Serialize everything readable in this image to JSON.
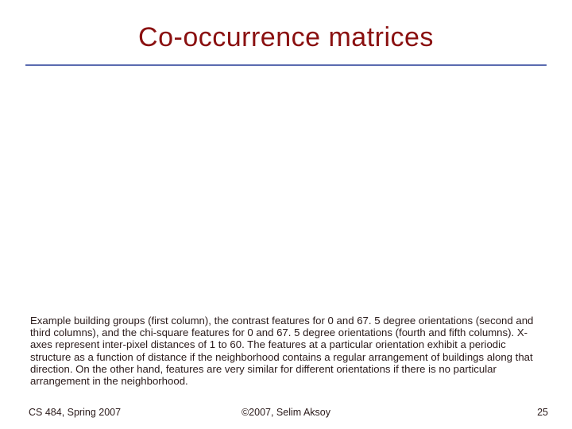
{
  "slide": {
    "title": "Co-occurrence matrices",
    "body": "Example building groups (first column), the contrast features for 0 and 67. 5 degree orientations (second and third columns), and the chi-square features for 0 and 67. 5 degree orientations (fourth and fifth columns). X-axes represent inter-pixel distances of 1 to 60. The features at a particular orientation exhibit a periodic structure as a function of distance if the neighborhood contains a regular arrangement of buildings along that direction. On the other hand, features are very similar for different orientations if there is no particular arrangement in the neighborhood."
  },
  "footer": {
    "left": "CS 484, Spring 2007",
    "center": "©2007, Selim Aksoy",
    "right": "25"
  }
}
